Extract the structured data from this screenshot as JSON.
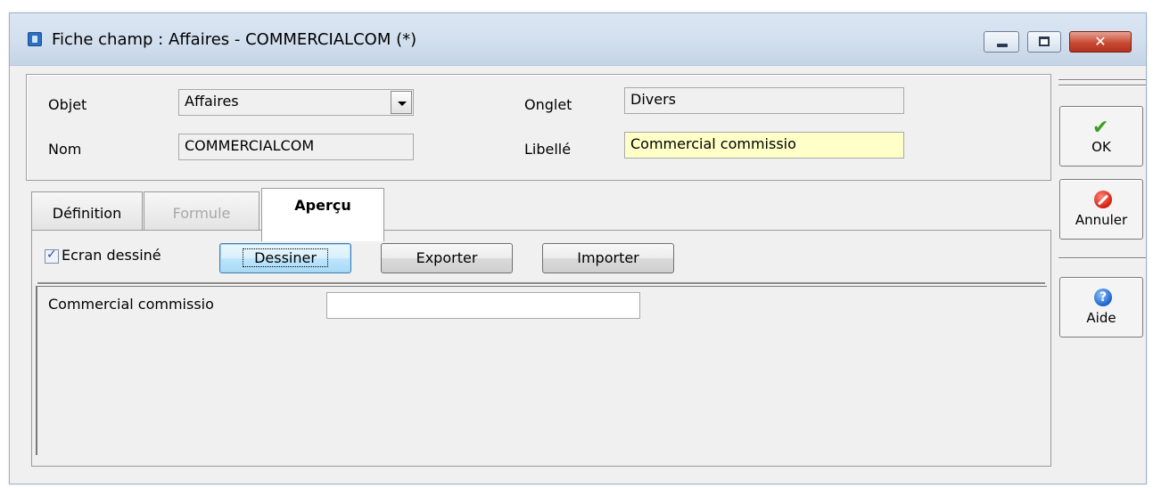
{
  "window": {
    "title": "Fiche champ : Affaires - COMMERCIALCOM (*)",
    "close_glyph": "✕"
  },
  "form": {
    "objet_label": "Objet",
    "objet_value": "Affaires",
    "nom_label": "Nom",
    "nom_value": "COMMERCIALCOM",
    "onglet_label": "Onglet",
    "onglet_value": "Divers",
    "libelle_label": "Libellé",
    "libelle_value": "Commercial commissio"
  },
  "tabs": [
    {
      "label": "Définition",
      "state": "normal"
    },
    {
      "label": "Formule",
      "state": "disabled"
    },
    {
      "label": "Aperçu",
      "state": "active"
    }
  ],
  "apercu": {
    "checkbox_label": "Ecran dessiné",
    "checkbox_checked": true,
    "dessiner_label": "Dessiner",
    "exporter_label": "Exporter",
    "importer_label": "Importer",
    "preview_field_label": "Commercial commissio",
    "preview_field_value": ""
  },
  "side_buttons": {
    "ok_label": "OK",
    "annuler_label": "Annuler",
    "aide_label": "Aide"
  },
  "icons": {
    "ok": "checkmark-icon",
    "annuler": "stop-icon",
    "aide": "help-icon"
  }
}
